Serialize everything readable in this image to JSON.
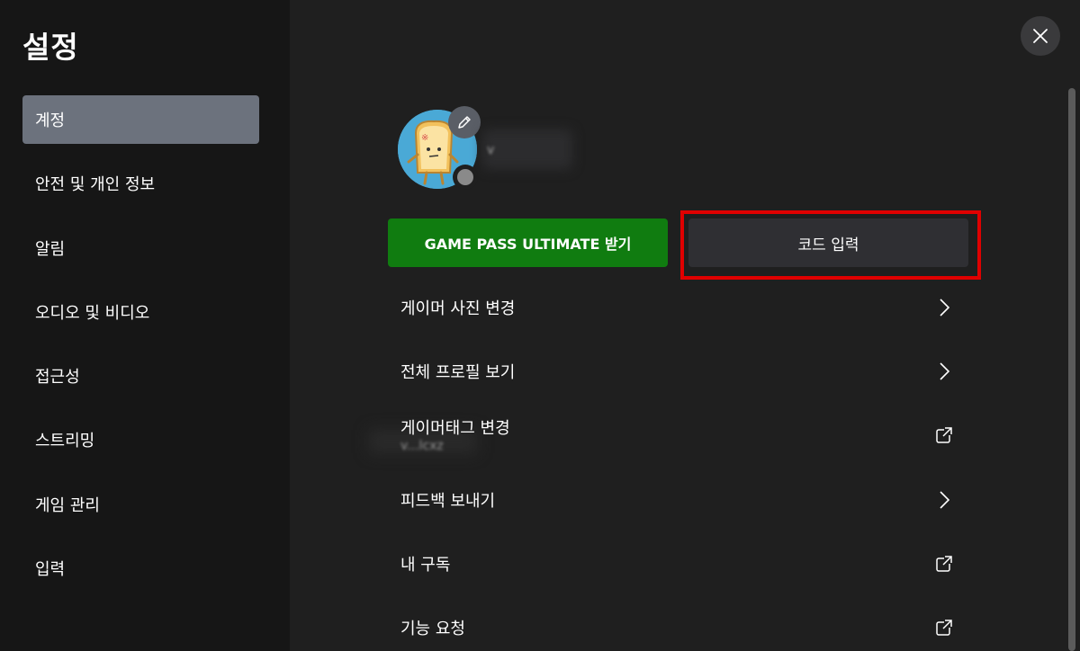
{
  "sidebar": {
    "title": "설정",
    "items": [
      {
        "label": "계정",
        "active": true
      },
      {
        "label": "안전 및 개인 정보",
        "active": false
      },
      {
        "label": "알림",
        "active": false
      },
      {
        "label": "오디오 및 비디오",
        "active": false
      },
      {
        "label": "접근성",
        "active": false
      },
      {
        "label": "스트리밍",
        "active": false
      },
      {
        "label": "게임 관리",
        "active": false
      },
      {
        "label": "입력",
        "active": false
      }
    ]
  },
  "profile": {
    "gamertag_blurred": "v"
  },
  "buttons": {
    "gamepass_label": "GAME PASS ULTIMATE 받기",
    "redeem_code_label": "코드 입력"
  },
  "menu": [
    {
      "label": "게이머 사진 변경",
      "icon": "chevron-right-icon"
    },
    {
      "label": "전체 프로필 보기",
      "icon": "chevron-right-icon"
    },
    {
      "label": "게이머태그 변경",
      "sublabel": "v...lcxz",
      "icon": "external-link-icon"
    },
    {
      "label": "피드백 보내기",
      "icon": "chevron-right-icon"
    },
    {
      "label": "내 구독",
      "icon": "external-link-icon"
    },
    {
      "label": "기능 요청",
      "icon": "external-link-icon"
    }
  ],
  "colors": {
    "sidebar_bg": "#161616",
    "main_bg": "#1f1f1f",
    "active_item": "#6c727d",
    "gamepass_green": "#107c10",
    "highlight_red": "#e00000",
    "avatar_bg": "#4aa9d6"
  }
}
